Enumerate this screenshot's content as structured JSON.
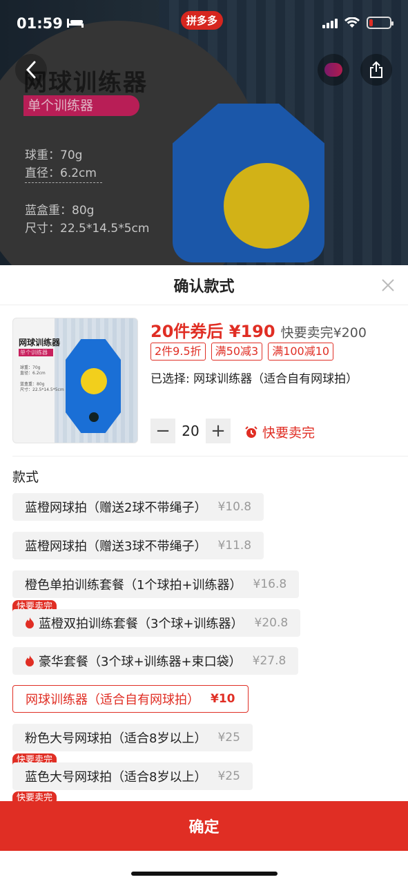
{
  "status_bar": {
    "time": "01:59"
  },
  "banner": {
    "brand": "拼多多",
    "title": "网球训练器",
    "tag": "单个训练器",
    "specs": [
      "球重：70g",
      "直径：6.2cm",
      "蓝盒重：80g",
      "尺寸：22.5*14.5*5cm"
    ]
  },
  "sheet": {
    "title": "确认款式",
    "thumb": {
      "title": "网球训练器",
      "tag": "单个训练器",
      "specs": [
        "球重：70g",
        "直径：6.2cm",
        "蓝盒重：80g",
        "尺寸：22.5*14.5*5cm"
      ]
    },
    "price": "20件券后 ¥190",
    "price_old": "快要卖完¥200",
    "coupons": [
      "2件9.5折",
      "满50减3",
      "满100减10"
    ],
    "selected": "已选择: 网球训练器（适合自有网球拍）",
    "qty_minus": "−",
    "qty_value": "20",
    "qty_plus": "+",
    "sellout": "快要卖完",
    "section": "款式",
    "badge": "快要卖完",
    "options": [
      {
        "name": "蓝橙网球拍（赠送2球不带绳子）",
        "price": "¥10.8"
      },
      {
        "name": "蓝橙网球拍（赠送3球不带绳子）",
        "price": "¥11.8"
      },
      {
        "name": "橙色单拍训练套餐（1个球拍+训练器）",
        "price": "¥16.8"
      },
      {
        "name": "蓝橙双拍训练套餐（3个球+训练器）",
        "price": "¥20.8"
      },
      {
        "name": "豪华套餐（3个球+训练器+束口袋）",
        "price": "¥27.8"
      },
      {
        "name": "网球训练器（适合自有网球拍）",
        "price": "¥10"
      },
      {
        "name": "粉色大号网球拍（适合8岁以上）",
        "price": "¥25"
      },
      {
        "name": "蓝色大号网球拍（适合8岁以上）",
        "price": "¥25"
      }
    ],
    "confirm": "确定"
  }
}
